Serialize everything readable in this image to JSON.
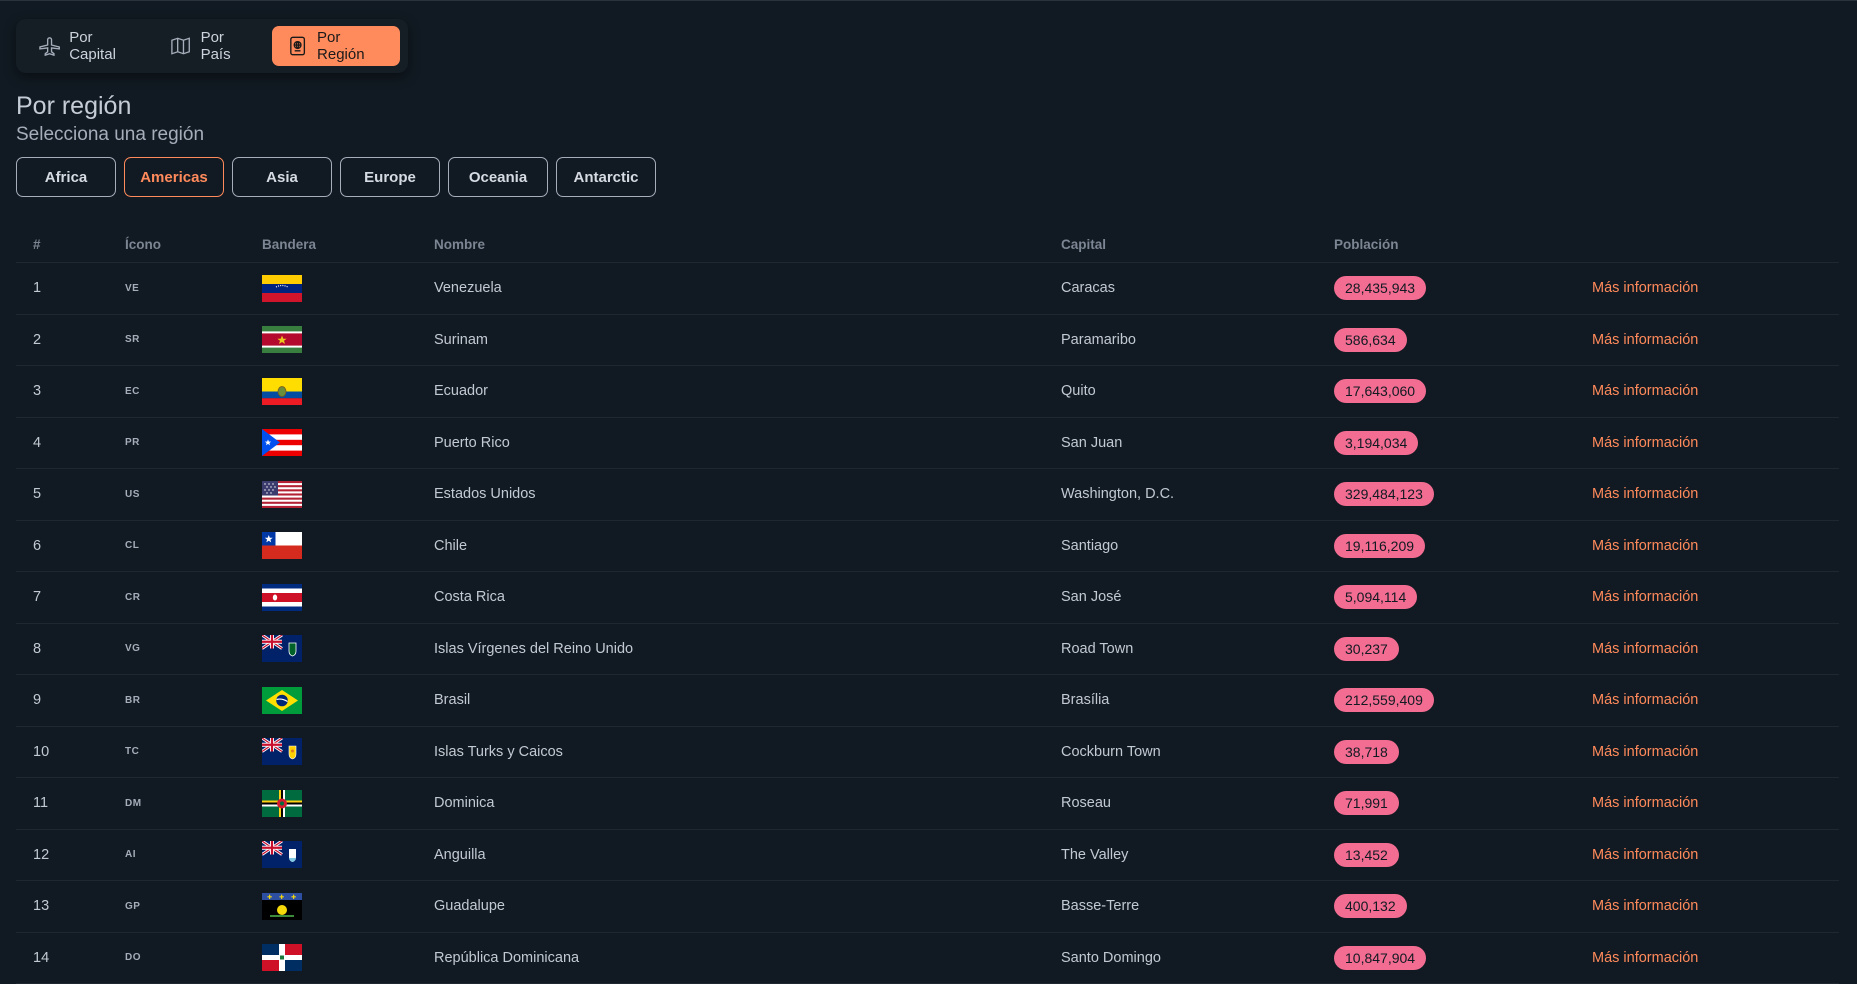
{
  "nav": {
    "tabs": [
      {
        "label": "Por Capital",
        "icon": "plane-icon"
      },
      {
        "label": "Por País",
        "icon": "map-icon"
      },
      {
        "label": "Por Región",
        "icon": "passport-icon"
      }
    ],
    "active_index": 2
  },
  "page": {
    "title": "Por región",
    "subtitle": "Selecciona una región"
  },
  "regions": {
    "options": [
      "Africa",
      "Americas",
      "Asia",
      "Europe",
      "Oceania",
      "Antarctic"
    ],
    "selected": "Americas"
  },
  "table": {
    "headers": {
      "num": "#",
      "icon": "Ícono",
      "flag": "Bandera",
      "name": "Nombre",
      "capital": "Capital",
      "population": "Población"
    },
    "more_label": "Más información",
    "rows": [
      {
        "num": "1",
        "code": "VE",
        "name": "Venezuela",
        "capital": "Caracas",
        "population": "28,435,943"
      },
      {
        "num": "2",
        "code": "SR",
        "name": "Surinam",
        "capital": "Paramaribo",
        "population": "586,634"
      },
      {
        "num": "3",
        "code": "EC",
        "name": "Ecuador",
        "capital": "Quito",
        "population": "17,643,060"
      },
      {
        "num": "4",
        "code": "PR",
        "name": "Puerto Rico",
        "capital": "San Juan",
        "population": "3,194,034"
      },
      {
        "num": "5",
        "code": "US",
        "name": "Estados Unidos",
        "capital": "Washington, D.C.",
        "population": "329,484,123"
      },
      {
        "num": "6",
        "code": "CL",
        "name": "Chile",
        "capital": "Santiago",
        "population": "19,116,209"
      },
      {
        "num": "7",
        "code": "CR",
        "name": "Costa Rica",
        "capital": "San José",
        "population": "5,094,114"
      },
      {
        "num": "8",
        "code": "VG",
        "name": "Islas Vírgenes del Reino Unido",
        "capital": "Road Town",
        "population": "30,237"
      },
      {
        "num": "9",
        "code": "BR",
        "name": "Brasil",
        "capital": "Brasília",
        "population": "212,559,409"
      },
      {
        "num": "10",
        "code": "TC",
        "name": "Islas Turks y Caicos",
        "capital": "Cockburn Town",
        "population": "38,718"
      },
      {
        "num": "11",
        "code": "DM",
        "name": "Dominica",
        "capital": "Roseau",
        "population": "71,991"
      },
      {
        "num": "12",
        "code": "AI",
        "name": "Anguilla",
        "capital": "The Valley",
        "population": "13,452"
      },
      {
        "num": "13",
        "code": "GP",
        "name": "Guadalupe",
        "capital": "Basse-Terre",
        "population": "400,132"
      },
      {
        "num": "14",
        "code": "DO",
        "name": "República Dominicana",
        "capital": "Santo Domingo",
        "population": "10,847,904"
      }
    ]
  },
  "colors": {
    "accent": "#ff8a5b",
    "badge": "#f36d92",
    "background": "#111a22"
  }
}
